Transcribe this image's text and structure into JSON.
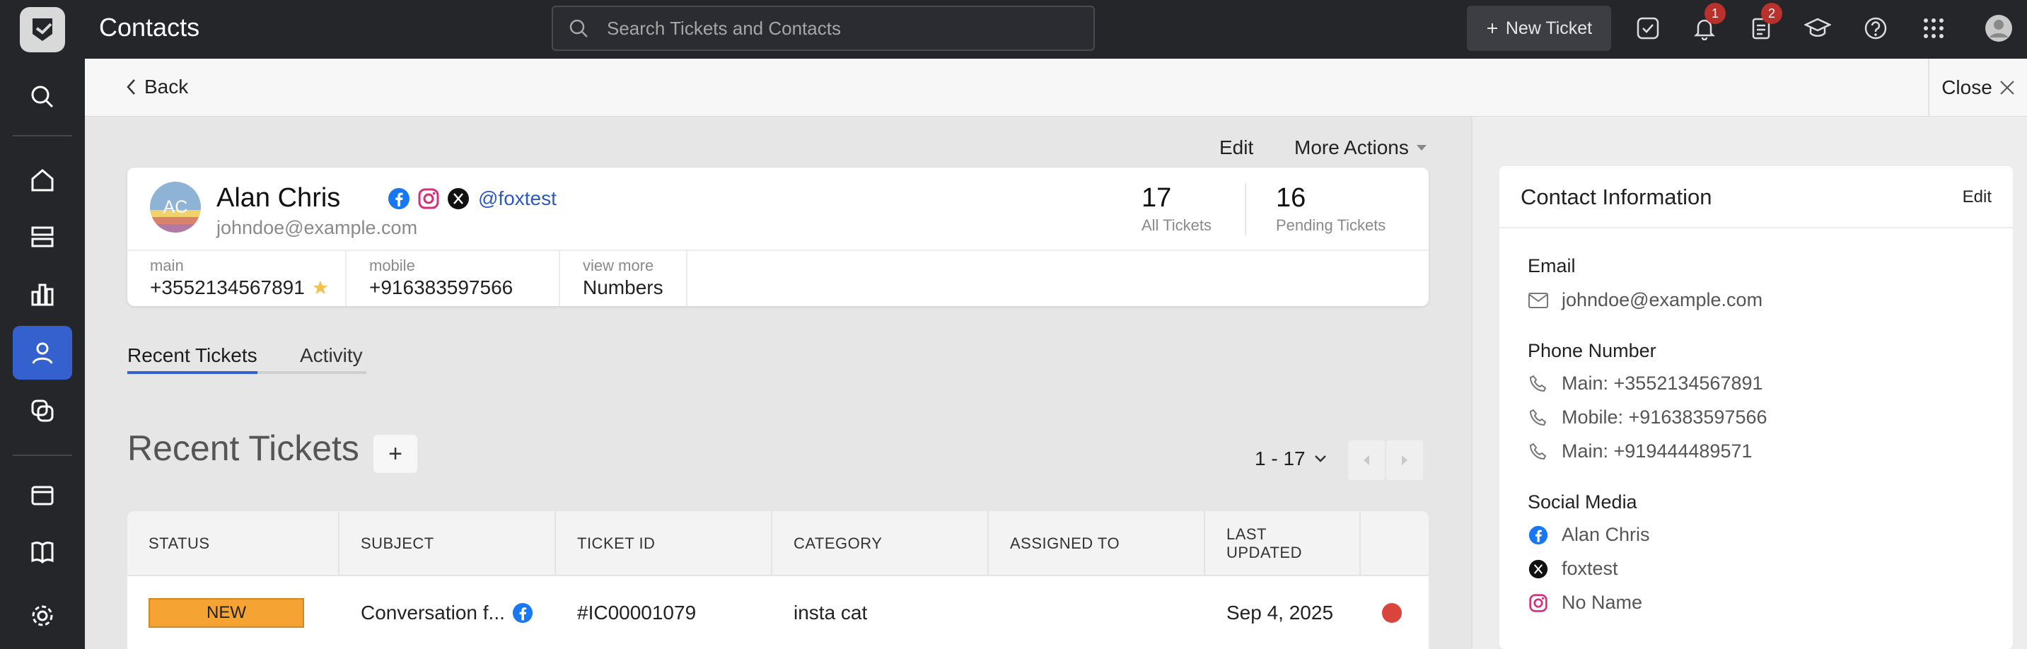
{
  "app": {
    "title": "Contacts"
  },
  "search": {
    "placeholder": "Search Tickets and Contacts"
  },
  "topbar": {
    "new_ticket_label": "New Ticket",
    "notifications_count": "1",
    "tasks_count": "2"
  },
  "subheader": {
    "back_label": "Back",
    "close_label": "Close"
  },
  "actions": {
    "edit_label": "Edit",
    "more_actions_label": "More Actions"
  },
  "contact": {
    "avatar_initials": "AC",
    "name": "Alan Chris",
    "handle": "@foxtest",
    "email": "johndoe@example.com",
    "stats": [
      {
        "value": "17",
        "label": "All Tickets"
      },
      {
        "value": "16",
        "label": "Pending Tickets"
      }
    ],
    "phones": [
      {
        "label": "main",
        "value": "+3552134567891",
        "starred": true
      },
      {
        "label": "mobile",
        "value": "+916383597566"
      },
      {
        "label": "view more",
        "value": "Numbers"
      }
    ]
  },
  "tabs": [
    {
      "label": "Recent Tickets",
      "active": true
    },
    {
      "label": "Activity",
      "active": false
    }
  ],
  "recent": {
    "title": "Recent Tickets",
    "add_label": "+",
    "pagination": "1 - 17",
    "columns": [
      "STATUS",
      "SUBJECT",
      "TICKET ID",
      "CATEGORY",
      "ASSIGNED TO",
      "LAST UPDATED"
    ],
    "rows": [
      {
        "status": "NEW",
        "subject": "Conversation f...",
        "channel_icon": "facebook-icon",
        "ticket_id": "#IC00001079",
        "category": "insta cat",
        "assigned_to": "",
        "last_updated": "Sep 4, 2025",
        "priority_color": "#d9453d"
      }
    ]
  },
  "contact_info": {
    "title": "Contact Information",
    "edit_label": "Edit",
    "email_label": "Email",
    "email": "johndoe@example.com",
    "phone_label": "Phone Number",
    "phones": [
      "Main: +3552134567891",
      "Mobile: +916383597566",
      "Main: +919444489571"
    ],
    "social_label": "Social Media",
    "social": [
      {
        "icon": "facebook-icon",
        "text": "Alan Chris"
      },
      {
        "icon": "x-icon",
        "text": "foxtest"
      },
      {
        "icon": "instagram-icon",
        "text": "No Name"
      }
    ]
  },
  "colors": {
    "accent": "#3561cf",
    "topbar": "#25262a",
    "status_new": "#f5a332",
    "badge": "#b8312b",
    "link": "#2b59c3"
  }
}
